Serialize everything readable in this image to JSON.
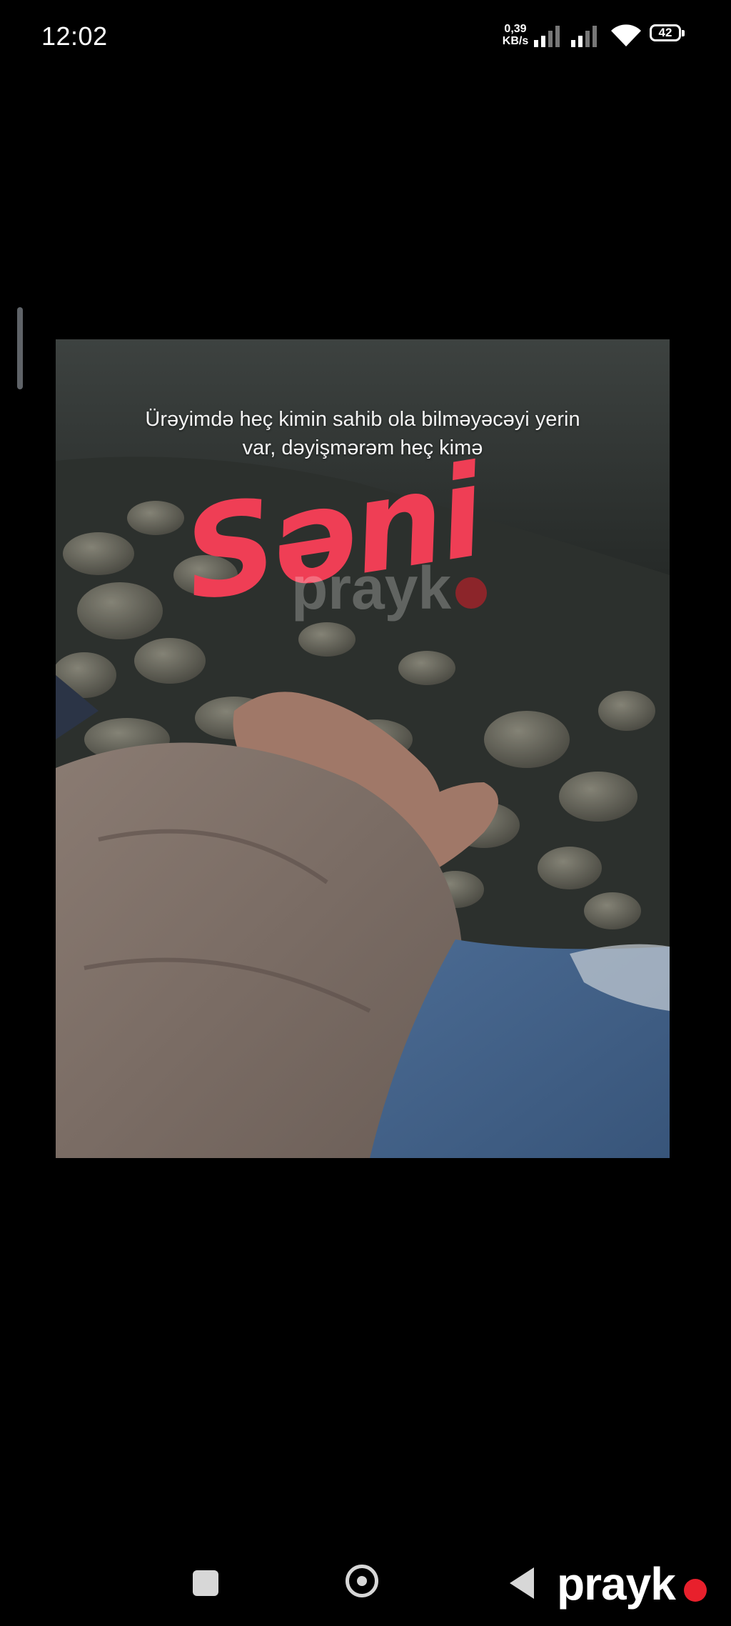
{
  "status_bar": {
    "time": "12:02",
    "net_speed_value": "0,39",
    "net_speed_unit": "KB/s",
    "battery_level": "42"
  },
  "image": {
    "caption_line1": "Ürəyimdə heç kimin sahib ola bilməyəcəyi yerin",
    "caption_line2": "var, dəyişmərəm heç kimə",
    "overlay_word": "Səni",
    "center_watermark": "prayk"
  },
  "navigation": {
    "recent_icon": "square-icon",
    "home_icon": "circle-icon",
    "back_icon": "triangle-back-icon"
  },
  "watermark": {
    "brand": "prayk",
    "accent_color": "#e8202c"
  },
  "colors": {
    "overlay_word": "#ef3e55",
    "background": "#000000"
  }
}
